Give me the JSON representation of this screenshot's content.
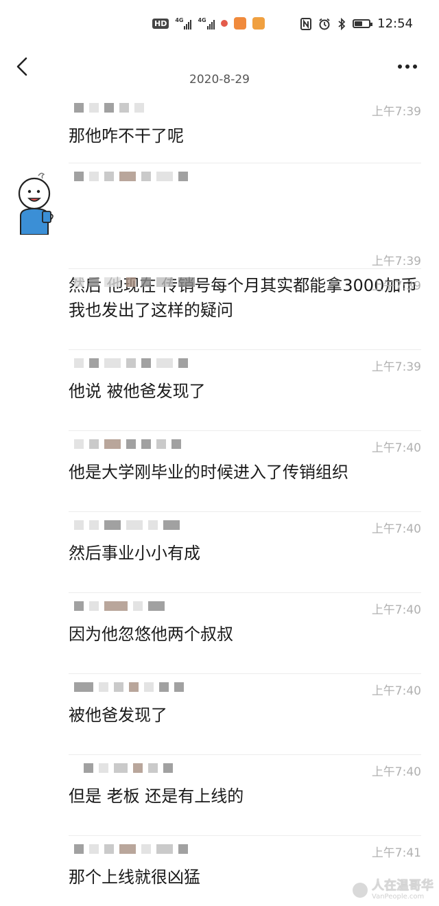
{
  "status_bar": {
    "hd_label": "HD",
    "network_1": "4G",
    "network_2": "4G",
    "time": "12:54",
    "battery_level": 0.5,
    "icons": [
      "hd-icon",
      "signal-4g-icon",
      "signal-4g-icon",
      "weibo-icon",
      "chat-app-icon",
      "notes-app-icon",
      "nfc-icon",
      "alarm-icon",
      "bluetooth-icon",
      "battery-icon"
    ]
  },
  "header": {
    "date": "2020-8-29",
    "back_icon": "chevron-left-icon",
    "more_icon": "more-dots-icon"
  },
  "messages": [
    {
      "time": "上午7:39",
      "text": "那他咋不干了呢"
    },
    {
      "time": "上午7:39",
      "text": "然后 他现在 传销号每个月其实都能拿3000加币"
    },
    {
      "time": "上午7:39",
      "text": "我也发出了这样的疑问"
    },
    {
      "time": "上午7:39",
      "text": "他说 被他爸发现了"
    },
    {
      "time": "上午7:40",
      "text": "他是大学刚毕业的时候进入了传销组织"
    },
    {
      "time": "上午7:40",
      "text": "然后事业小小有成"
    },
    {
      "time": "上午7:40",
      "text": "因为他忽悠他两个叔叔"
    },
    {
      "time": "上午7:40",
      "text": "被他爸发现了"
    },
    {
      "time": "上午7:40",
      "text": "但是 老板 还是有上线的"
    },
    {
      "time": "上午7:41",
      "text": "那个上线就很凶猛"
    }
  ],
  "watermark": {
    "main": "人在温哥华",
    "sub": "VanPeople.com"
  }
}
